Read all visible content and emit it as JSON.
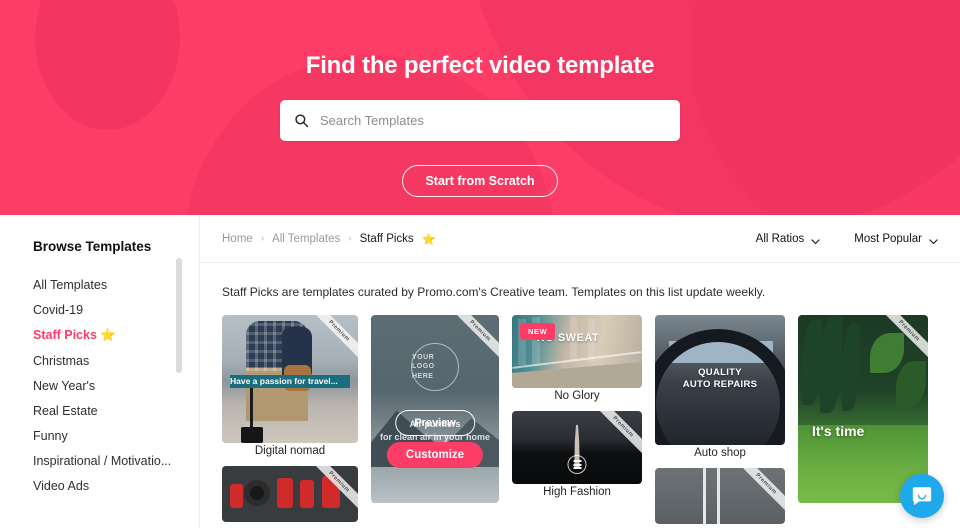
{
  "hero": {
    "title": "Find the perfect video template",
    "search": {
      "placeholder": "Search Templates",
      "value": "",
      "icon": "search-icon"
    },
    "scratch_button": "Start from Scratch",
    "background_color": "#FD3D66"
  },
  "sidebar": {
    "title": "Browse Templates",
    "items": [
      {
        "label": "All Templates",
        "active": false
      },
      {
        "label": "Covid-19",
        "active": false
      },
      {
        "label": "Staff Picks",
        "star": "⭐",
        "active": true
      },
      {
        "label": "Christmas",
        "active": false
      },
      {
        "label": "New Year's",
        "active": false
      },
      {
        "label": "Real Estate",
        "active": false
      },
      {
        "label": "Funny",
        "active": false
      },
      {
        "label": "Inspirational / Motivatio...",
        "active": false
      },
      {
        "label": "Video Ads",
        "active": false
      }
    ],
    "active_color": "#FD3D66"
  },
  "breadcrumb": {
    "items": [
      "Home",
      "All Templates",
      "Staff Picks"
    ],
    "separator": "›",
    "star": "⭐"
  },
  "filters": [
    {
      "label": "All Ratios",
      "icon": "chevron-down-icon"
    },
    {
      "label": "Most Popular",
      "icon": "chevron-down-icon"
    }
  ],
  "blurb": "Staff Picks are templates curated by Promo.com's Creative team. Templates on this list update weekly.",
  "cards": {
    "digital_nomad": {
      "label": "Digital nomad",
      "overlay_text": "Have a passion for travel...",
      "ribbon": "Premium"
    },
    "car_parts": {
      "label": "",
      "ribbon": "Premium"
    },
    "air_purifier": {
      "label": "",
      "ribbon": "Premium",
      "logo_text": "YOUR LOGO HERE",
      "caption_line1": "Air purifiers",
      "caption_line2": "for clean air in your home",
      "hover_preview": "Preview",
      "hover_customize": "Customize",
      "customize_color": "#FD3D66"
    },
    "no_glory": {
      "label": "No Glory",
      "badge": "NEW",
      "badge_color": "#FD3D66",
      "overlay_text": "NO SWEAT"
    },
    "high_fashion": {
      "label": "High Fashion",
      "ribbon": "Premium"
    },
    "auto_shop": {
      "label": "Auto shop",
      "overlay_text": "QUALITY AUTO REPAIRS",
      "overlay_line1": "QUALITY",
      "overlay_line2": "AUTO REPAIRS"
    },
    "road": {
      "label": "",
      "ribbon": "Premium"
    },
    "its_time": {
      "label": "",
      "overlay_text": "It's time",
      "ribbon": "Premium"
    }
  },
  "intercom": {
    "icon": "chat-bubble-icon",
    "color": "#1DA9EC"
  }
}
